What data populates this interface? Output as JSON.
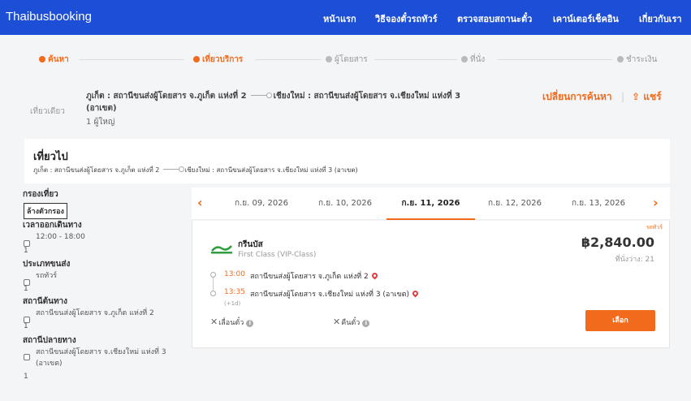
{
  "brand": "Thaibusbooking",
  "nav": [
    "หน้าแรก",
    "วิธีจองตั๋วรถทัวร์",
    "ตรวจสอบสถานะตั๋ว",
    "เคาน์เตอร์เช็คอิน",
    "เกี่ยวกับเรา"
  ],
  "steps": [
    {
      "label": "ค้นหา",
      "state": "done"
    },
    {
      "label": "เที่ยวบริการ",
      "state": "current"
    },
    {
      "label": "ผู้โดยสาร",
      "state": "upcoming"
    },
    {
      "label": "ที่นั่ง",
      "state": "upcoming"
    },
    {
      "label": "ชำระเงิน",
      "state": "upcoming"
    }
  ],
  "summary": {
    "trip_type": "เที่ยวเดียว",
    "from": "ภูเก็ต : สถานีขนส่งผู้โดยสาร จ.ภูเก็ต แห่งที่ 2",
    "to": "เชียงใหม่ : สถานีขนส่งผู้โดยสาร จ.เชียงใหม่ แห่งที่ 3 (อาเขต)",
    "passengers": "1 ผู้ใหญ่",
    "change_label": "เปลี่ยนการค้นหา",
    "share_label": "แชร์"
  },
  "outbound": {
    "title": "เที่ยวไป",
    "from": "ภูเก็ต : สถานีขนส่งผู้โดยสาร จ.ภูเก็ต แห่งที่ 2",
    "to": "เชียงใหม่ : สถานีขนส่งผู้โดยสาร จ.เชียงใหม่ แห่งที่ 3 (อาเขต)"
  },
  "filters": {
    "title": "กรองเที่ยว",
    "clear_label": "ล้างตัวกรอง",
    "groups": [
      {
        "heading": "เวลาออกเดินทาง",
        "option": "12:00 - 18:00",
        "count": "1"
      },
      {
        "heading": "ประเภทขนส่ง",
        "option": "รถทัวร์",
        "count": "1"
      },
      {
        "heading": "สถานีต้นทาง",
        "option": "สถานีขนส่งผู้โดยสาร จ.ภูเก็ต แห่งที่ 2",
        "count": "1"
      },
      {
        "heading": "สถานีปลายทาง",
        "option": "สถานีขนส่งผู้โดยสาร จ.เชียงใหม่ แห่งที่ 3",
        "option2": "(อาเขต)",
        "count": "1"
      }
    ]
  },
  "dates": [
    "ก.ย. 09, 2026",
    "ก.ย. 10, 2026",
    "ก.ย. 11, 2026",
    "ก.ย. 12, 2026",
    "ก.ย. 13, 2026"
  ],
  "active_date_index": 2,
  "trip": {
    "tag": "รถทัวร์",
    "operator": "กรีนบัส",
    "class": "First Class (VIP-Class)",
    "price": "฿2,840.00",
    "seats": "ที่นั่งว่าง: 21",
    "depart_time": "13:00",
    "depart_stop": "สถานีขนส่งผู้โดยสาร จ.ภูเก็ต แห่งที่ 2",
    "arrive_time": "13:35",
    "arrive_stop": "สถานีขนส่งผู้โดยสาร จ.เชียงใหม่ แห่งที่ 3 (อาเขต)",
    "next_day": "(+1d)",
    "reschedule": "เลื่อนตั๋ว",
    "refund": "คืนตั๋ว",
    "select_label": "เลือก"
  },
  "colors": {
    "primary": "#1d4fd6",
    "accent": "#f26b1d",
    "pin": "#e23b3b",
    "logo_green": "#2e9e3e"
  }
}
